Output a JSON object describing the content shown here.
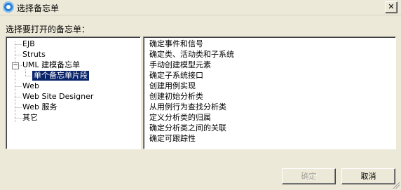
{
  "window": {
    "title": "选择备忘单",
    "close_glyph": "✕"
  },
  "prompt": "选择要打开的备忘单：",
  "tree": {
    "items": [
      {
        "label": "EJB"
      },
      {
        "label": "Struts"
      },
      {
        "label": "UML 建模备忘单",
        "expander": "−"
      },
      {
        "label": "单个备忘单片段",
        "selected": true
      },
      {
        "label": "Web"
      },
      {
        "label": "Web Site Designer"
      },
      {
        "label": "Web 服务"
      },
      {
        "label": "其它"
      }
    ]
  },
  "list": {
    "items": [
      "确定事件和信号",
      "确定类、活动类和子系统",
      "手动创建模型元素",
      "确定子系统接口",
      "创建用例实现",
      "创建初始分析类",
      "从用例行为查找分析类",
      "定义分析类的归属",
      "确定分析类之间的关联",
      "确定可跟踪性"
    ]
  },
  "buttons": {
    "ok_label": "确定",
    "ok_disabled": true,
    "cancel_label": "取消"
  },
  "icons": {
    "app": "app-icon",
    "close": "close-icon"
  },
  "colors": {
    "selection": "#0a246a",
    "dialog_bg": "#ece9d8"
  }
}
